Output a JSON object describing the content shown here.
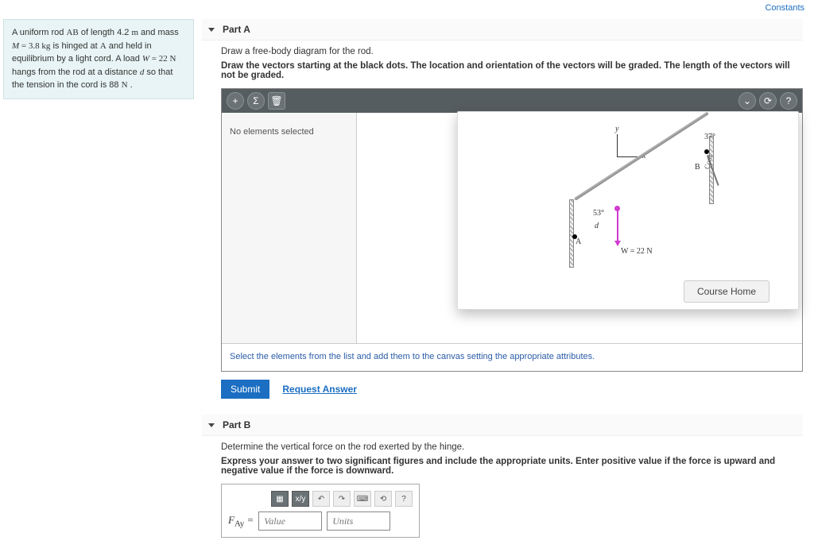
{
  "header": {
    "constants": "Constants"
  },
  "problem": {
    "html": "A uniform rod <span class='math'><span class='rm'>AB</span></span> of length 4.2 <span class='math'><span class='rm'>m</span></span> and mass <span class='math'><span class='var'>M</span> = 3.8 <span class='rm'>kg</span></span> is hinged at <span class='math'><span class='rm'>A</span></span> and held in equilibrium by a light cord. A load <span class='math'><span class='var'>W</span> = 22 <span class='rm'>N</span></span> hangs from the rod at a distance <span class='math'><span class='var'>d</span></span> so that the tension in the cord is 88 <span class='math'><span class='rm'>N</span></span> ."
  },
  "partA": {
    "title": "Part A",
    "line1": "Draw a free-body diagram for the rod.",
    "line2": "Draw the vectors starting at the black dots. The location and orientation of the vectors will be graded. The length of the vectors will not be graded.",
    "sidebar_msg": "No elements selected",
    "footer_msg": "Select the elements from the list and add them to the canvas setting the appropriate attributes.",
    "diagram": {
      "angle53": "53°",
      "angle37": "37°",
      "A": "A",
      "B": "B",
      "d": "d",
      "x": "x",
      "y": "y",
      "cord": "Cord",
      "W": "W = 22 N"
    },
    "course_home": "Course Home",
    "submit": "Submit",
    "request": "Request Answer",
    "tb": {
      "plus": "+",
      "sigma": "Σ",
      "trash": "🗑",
      "down": "⌄",
      "reset": "⟳",
      "help": "?"
    }
  },
  "partB": {
    "title": "Part B",
    "line1": "Determine the vertical force on the rod exerted by the hinge.",
    "line2": "Express your answer to two significant figures and include the appropriate units. Enter positive value if the force is upward and negative value if the force is downward.",
    "label_html": "<span class='var'>F</span><sub><span class='rm'>Ay</span></sub> =",
    "value_ph": "Value",
    "units_ph": "Units",
    "tb": {
      "tpl": "▦",
      "frac": "x/y",
      "undo": "↶",
      "redo": "↷",
      "keys": "⌨",
      "reset": "⟲",
      "help": "?"
    }
  }
}
